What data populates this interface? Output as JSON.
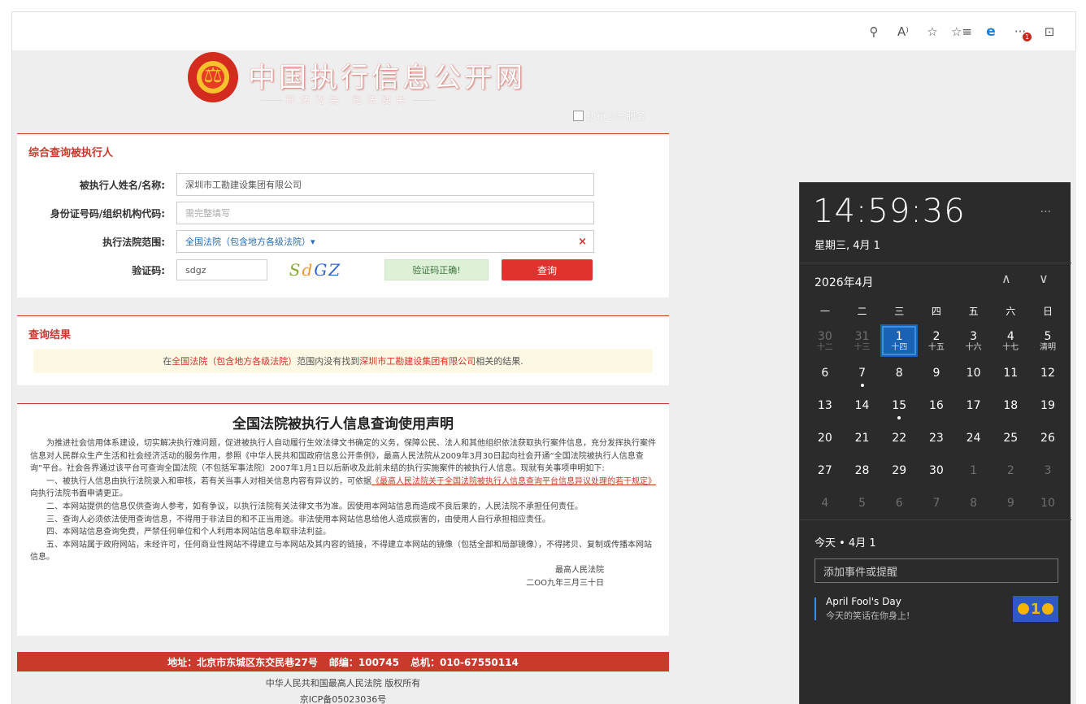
{
  "browser": {
    "icons": [
      "zoom-icon",
      "read-aloud-icon",
      "favorite-star-icon",
      "favorites-icon",
      "edge-icon",
      "more-icon",
      "split-screen-icon"
    ],
    "zoom_glyph": "⚲",
    "read_glyph": "A⁾",
    "star_glyph": "☆",
    "favs_glyph": "☆≡",
    "edge_glyph": "e",
    "more_glyph": "···",
    "more_badge": "1",
    "split_glyph": "⊡"
  },
  "header": {
    "emblem_char": "⚖",
    "title": "中国执行信息公开网",
    "slogan": "司法为民  司法便民",
    "service_link": "执行公开服务"
  },
  "search": {
    "panel_title": "综合查询被执行人",
    "name_label": "被执行人姓名/名称:",
    "name_value": "深圳市工勘建设集团有限公司",
    "id_label": "身份证号码/组织机构代码:",
    "id_placeholder": "需完整填写",
    "court_label": "执行法院范围:",
    "court_value": "全国法院（包含地方各级法院）▾",
    "court_clear": "×",
    "captcha_label": "验证码:",
    "captcha_value": "sdgz",
    "captcha_chars": [
      "S",
      "d",
      "G",
      "Z"
    ],
    "verify_status": "验证码正确!",
    "query_button": "查询"
  },
  "result": {
    "panel_title": "查询结果",
    "msg_prefix": "在",
    "msg_scope": "全国法院（包含地方各级法院）",
    "msg_middle": "范围内没有找到",
    "msg_name": "深圳市工勘建设集团有限公司",
    "msg_suffix": "相关的结果."
  },
  "notice": {
    "title": "全国法院被执行人信息查询使用声明",
    "para1": "为推进社会信用体系建设，切实解决执行难问题，促进被执行人自动履行生效法律文书确定的义务，保障公民、法人和其他组织依法获取执行案件信息，充分发挥执行案件信息对人民群众生产生活和社会经济活动的服务作用，参照《中华人民共和国政府信息公开条例》，最高人民法院从2009年3月30日起向社会开通“全国法院被执行人信息查询”平台。社会各界通过该平台可查询全国法院（不包括军事法院）2007年1月1日以后新收及此前未结的执行实施案件的被执行人信息。现就有关事项申明如下:",
    "para2_prefix": "一、被执行人信息由执行法院录入和审核，若有关当事人对相关信息内容有异议的，可依据",
    "para2_link": "《最高人民法院关于全国法院被执行人信息查询平台信息异议处理的若干规定》",
    "para2_suffix": "向执行法院书面申请更正。",
    "para3": "二、本网站提供的信息仅供查询人参考，如有争议，以执行法院有关法律文书为准。因使用本网站信息而造成不良后果的，人民法院不承担任何责任。",
    "para4": "三、查询人必须依法使用查询信息，不得用于非法目的和不正当用途。非法使用本网站信息给他人造成损害的，由使用人自行承担相应责任。",
    "para5": "四、本网站信息查询免费，严禁任何单位和个人利用本网站信息牟取非法利益。",
    "para6": "五、本网站属于政府网站，未经许可，任何商业性网站不得建立与本网站及其内容的链接，不得建立本网站的镜像（包括全部和局部镜像），不得拷贝、复制或传播本网站信息。",
    "sign_org": "最高人民法院",
    "sign_date": "二OO九年三月三十日"
  },
  "footer": {
    "address": "地址：北京市东城区东交民巷27号",
    "postcode": "邮编：100745",
    "phone": "总机：010-67550114",
    "copyright": "中华人民共和国最高人民法院 版权所有",
    "icp": "京ICP备05023036号"
  },
  "flyout": {
    "time": "14:59:36",
    "more": "···",
    "date": "星期三, 4月 1",
    "month": "2026年4月",
    "up": "∧",
    "down": "∨",
    "weekdays": [
      "一",
      "二",
      "三",
      "四",
      "五",
      "六",
      "日"
    ],
    "days": [
      {
        "d": "30",
        "s": "十二",
        "dim": true
      },
      {
        "d": "31",
        "s": "十三",
        "dim": true
      },
      {
        "d": "1",
        "s": "十四",
        "today": true
      },
      {
        "d": "2",
        "s": "十五"
      },
      {
        "d": "3",
        "s": "十六"
      },
      {
        "d": "4",
        "s": "十七"
      },
      {
        "d": "5",
        "s": "清明"
      },
      {
        "d": "6"
      },
      {
        "d": "7",
        "dot": true
      },
      {
        "d": "8"
      },
      {
        "d": "9"
      },
      {
        "d": "10"
      },
      {
        "d": "11"
      },
      {
        "d": "12"
      },
      {
        "d": "13"
      },
      {
        "d": "14"
      },
      {
        "d": "15",
        "dot": true
      },
      {
        "d": "16"
      },
      {
        "d": "17"
      },
      {
        "d": "18"
      },
      {
        "d": "19"
      },
      {
        "d": "20"
      },
      {
        "d": "21"
      },
      {
        "d": "22"
      },
      {
        "d": "23"
      },
      {
        "d": "24"
      },
      {
        "d": "25"
      },
      {
        "d": "26"
      },
      {
        "d": "27"
      },
      {
        "d": "28"
      },
      {
        "d": "29"
      },
      {
        "d": "30"
      },
      {
        "d": "1",
        "dim": true
      },
      {
        "d": "2",
        "dim": true
      },
      {
        "d": "3",
        "dim": true
      },
      {
        "d": "4",
        "dim": true
      },
      {
        "d": "5",
        "dim": true
      },
      {
        "d": "6",
        "dim": true
      },
      {
        "d": "7",
        "dim": true
      },
      {
        "d": "8",
        "dim": true
      },
      {
        "d": "9",
        "dim": true
      },
      {
        "d": "10",
        "dim": true
      }
    ],
    "agenda_day": "今天 • 4月 1",
    "event_placeholder": "添加事件或提醒",
    "event_title": "April Fool's Day",
    "event_subtitle": "今天的笑话在你身上!",
    "event_image_text": "1"
  },
  "colors": {
    "accent_red": "#c9392c",
    "flyout_bg": "#2b2b2b",
    "today_blue": "#1a63b4"
  }
}
